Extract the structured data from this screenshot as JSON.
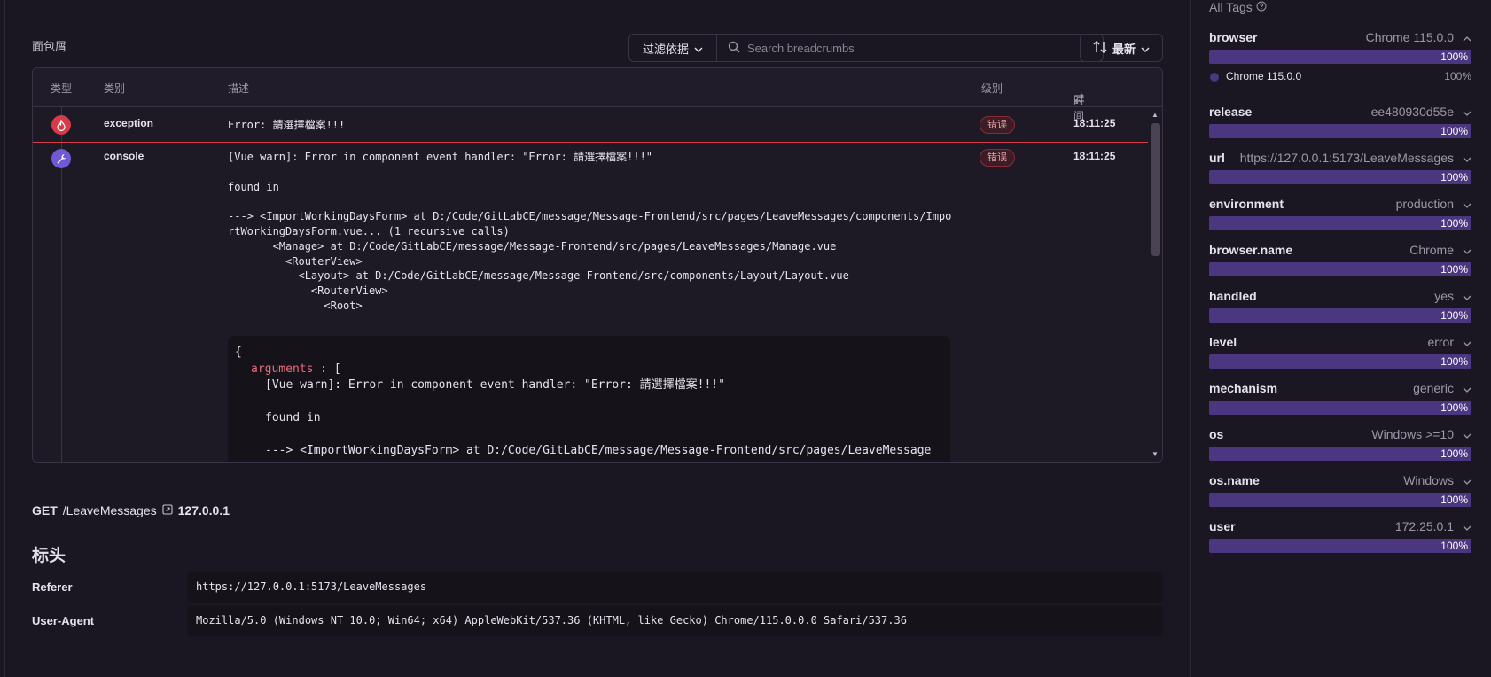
{
  "breadcrumbs": {
    "title": "面包屑",
    "filter_label": "过滤依据",
    "search_placeholder": "Search breadcrumbs",
    "sort_label": "最新",
    "columns": {
      "type": "类型",
      "category": "类别",
      "description": "描述",
      "level": "级别",
      "time": "时间"
    },
    "rows": [
      {
        "icon": "fire-icon",
        "category": "exception",
        "description": "Error: 請選擇檔案!!!",
        "level": "错误",
        "time": "18:11:25"
      },
      {
        "icon": "wrench-icon",
        "category": "console",
        "description": "[Vue warn]: Error in component event handler: \"Error: 請選擇檔案!!!\"\n\nfound in\n\n---> <ImportWorkingDaysForm> at D:/Code/GitLabCE/message/Message-Frontend/src/pages/LeaveMessages/components/Impo\nrtWorkingDaysForm.vue... (1 recursive calls)\n       <Manage> at D:/Code/GitLabCE/message/Message-Frontend/src/pages/LeaveMessages/Manage.vue\n         <RouterView>\n           <Layout> at D:/Code/GitLabCE/message/Message-Frontend/src/components/Layout/Layout.vue\n             <RouterView>\n               <Root>",
        "level": "错误",
        "time": "18:11:25",
        "data_open": "{",
        "data_key": "arguments",
        "data_after_key": ": [",
        "data_value": "[Vue warn]: Error in component event handler: \"Error: 請選擇檔案!!!\"\n\nfound in\n\n---> <ImportWorkingDaysForm> at D:/Code/GitLabCE/message/Message-Frontend/src/pages/LeaveMessage\ns/components/ImportWorkingDaysForm.vue... (1 recursive calls)\n       <Manage> at D:/Code/GitLabCE/message/Message-Frontend/src/pages/LeaveMessages/Ma"
      }
    ]
  },
  "request": {
    "method": "GET",
    "path": "/LeaveMessages",
    "host": "127.0.0.1"
  },
  "headers": {
    "title": "标头",
    "items": [
      {
        "key": "Referer",
        "value": "https://127.0.0.1:5173/LeaveMessages"
      },
      {
        "key": "User-Agent",
        "value": "Mozilla/5.0 (Windows NT 10.0; Win64; x64) AppleWebKit/537.36 (KHTML, like Gecko) Chrome/115.0.0.0 Safari/537.36"
      }
    ]
  },
  "tags": {
    "title": "All Tags",
    "items": [
      {
        "key": "browser",
        "value": "Chrome 115.0.0",
        "percent": "100%",
        "expanded": true
      },
      {
        "key": "release",
        "value": "ee480930d55e",
        "percent": "100%"
      },
      {
        "key": "url",
        "value": "https://127.0.0.1:5173/LeaveMessages",
        "percent": "100%"
      },
      {
        "key": "environment",
        "value": "production",
        "percent": "100%"
      },
      {
        "key": "browser.name",
        "value": "Chrome",
        "percent": "100%"
      },
      {
        "key": "handled",
        "value": "yes",
        "percent": "100%"
      },
      {
        "key": "level",
        "value": "error",
        "percent": "100%"
      },
      {
        "key": "mechanism",
        "value": "generic",
        "percent": "100%"
      },
      {
        "key": "os",
        "value": "Windows >=10",
        "percent": "100%"
      },
      {
        "key": "os.name",
        "value": "Windows",
        "percent": "100%"
      },
      {
        "key": "user",
        "value": "172.25.0.1",
        "percent": "100%"
      }
    ],
    "browser_detail": {
      "label": "Chrome 115.0.0",
      "percent": "100%"
    }
  },
  "colors": {
    "accent": "#4b3680",
    "error": "#d73b49",
    "console": "#6e5ad6"
  }
}
